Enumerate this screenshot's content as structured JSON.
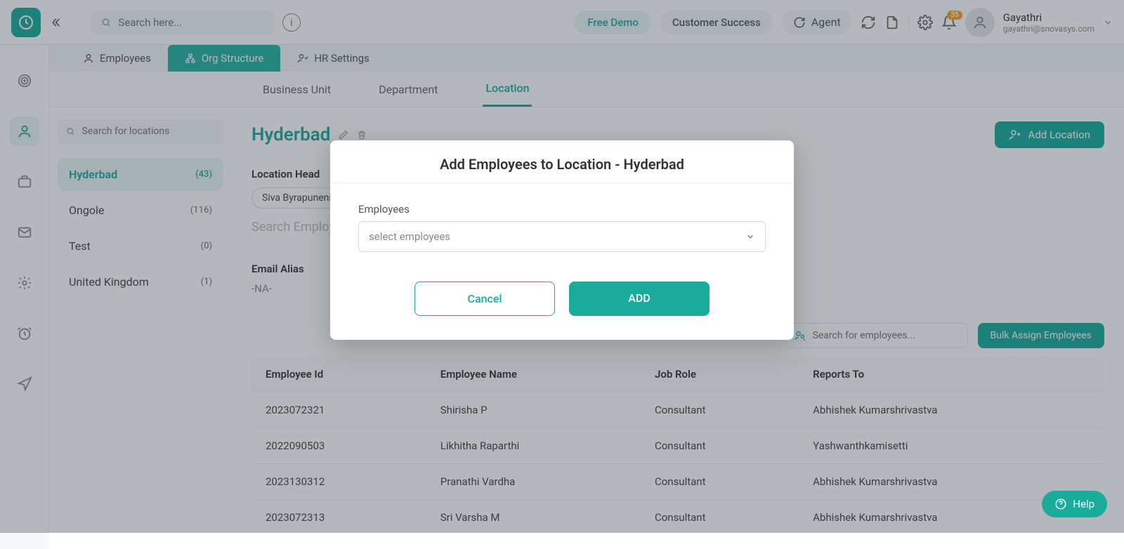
{
  "topbar": {
    "search_placeholder": "Search here...",
    "pill_free_demo": "Free Demo",
    "pill_customer_success": "Customer Success",
    "sync_label": "Agent",
    "notification_count": "35",
    "user_name": "Gayathri",
    "user_email": "gayathri@snovasys.com"
  },
  "tabs": {
    "employees": "Employees",
    "org_structure": "Org Structure",
    "hr_settings": "HR Settings"
  },
  "subtabs": {
    "business_unit": "Business Unit",
    "department": "Department",
    "location": "Location"
  },
  "loc_search_placeholder": "Search for locations",
  "locations": [
    {
      "name": "Hyderbad",
      "count": "(43)",
      "active": true
    },
    {
      "name": "Ongole",
      "count": "(116)",
      "active": false
    },
    {
      "name": "Test",
      "count": "(0)",
      "active": false
    },
    {
      "name": "United Kingdom",
      "count": "(1)",
      "active": false
    }
  ],
  "page": {
    "title": "Hyderbad",
    "add_location_btn": "Add Location",
    "location_head_label": "Location Head",
    "location_head_chip": "Siva Byrapuneni",
    "search_employee_placeholder": "Search Employee",
    "email_alias_label": "Email Alias",
    "email_alias_value": "-NA-",
    "emp_search_placeholder": "Search for employees...",
    "bulk_assign_btn": "Bulk Assign Employees"
  },
  "table": {
    "headers": [
      "Employee Id",
      "Employee Name",
      "Job Role",
      "Reports To"
    ],
    "rows": [
      {
        "id": "2023072321",
        "name": "Shirisha P",
        "role": "Consultant",
        "reports": "Abhishek Kumarshrivastva"
      },
      {
        "id": "2022090503",
        "name": "Likhitha Raparthi",
        "role": "Consultant",
        "reports": "Yashwanthkamisetti"
      },
      {
        "id": "2023130312",
        "name": "Pranathi Vardha",
        "role": "Consultant",
        "reports": "Abhishek Kumarshrivastva"
      },
      {
        "id": "2023072313",
        "name": "Sri Varsha M",
        "role": "Consultant",
        "reports": "Abhishek Kumarshrivastva"
      }
    ]
  },
  "modal": {
    "title": "Add Employees to Location - Hyderbad",
    "field_label": "Employees",
    "select_placeholder": "select employees",
    "cancel_btn": "Cancel",
    "add_btn": "ADD"
  },
  "help_label": "Help",
  "colors": {
    "accent": "#1aab9b",
    "accent_bg": "#e8f6f4",
    "badge": "#f5a623"
  }
}
